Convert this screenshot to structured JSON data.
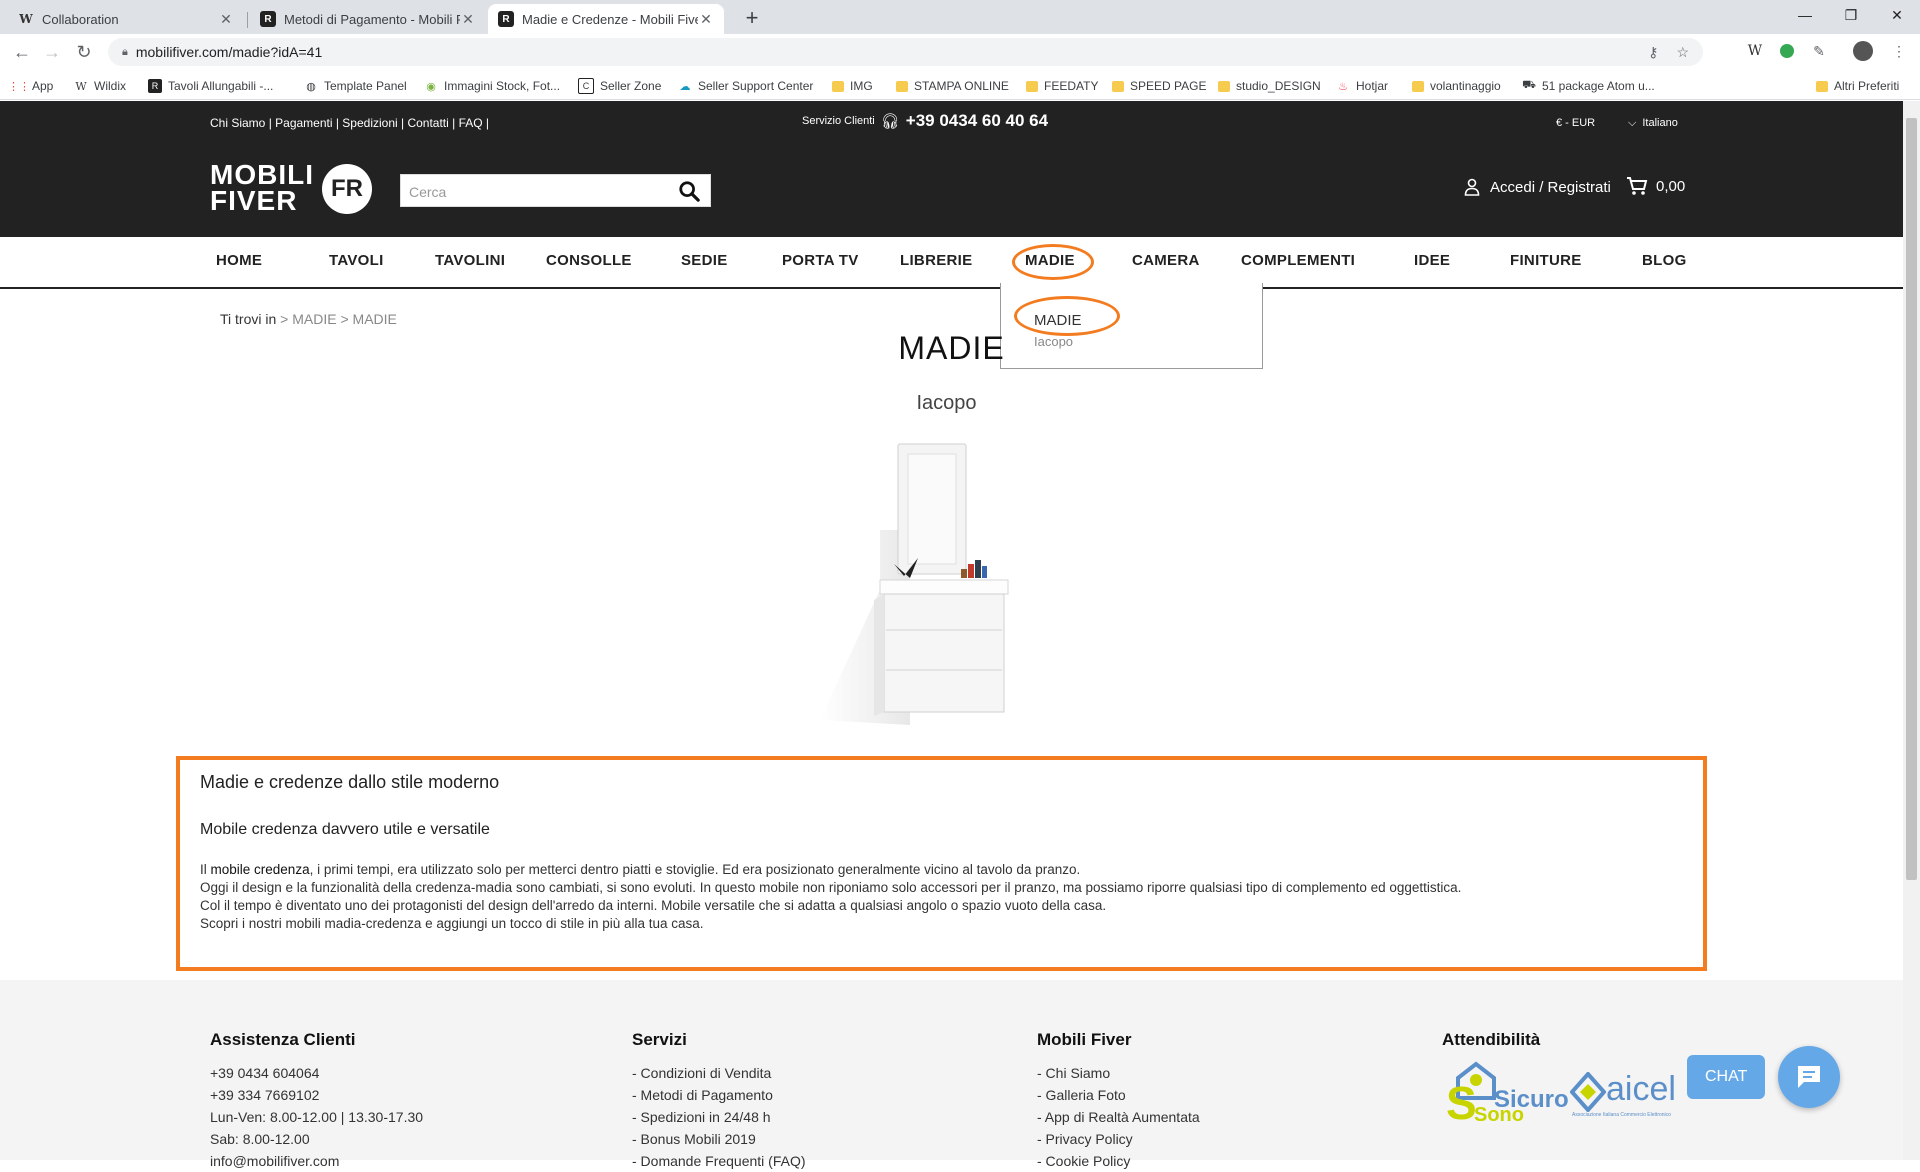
{
  "browser": {
    "tabs": [
      {
        "title": "Collaboration",
        "icon": "W"
      },
      {
        "title": "Metodi di Pagamento - Mobili Fiv",
        "icon": "R"
      },
      {
        "title": "Madie e Credenze - Mobili Fiver",
        "icon": "R"
      }
    ],
    "url": "mobilifiver.com/madie?idA=41",
    "bookmarks": [
      "App",
      "Wildix",
      "Tavoli Allungabili -...",
      "Template Panel",
      "Immagini Stock, Fot...",
      "Seller Zone",
      "Seller Support Center",
      "IMG",
      "STAMPA ONLINE",
      "FEEDATY",
      "SPEED PAGE",
      "studio_DESIGN",
      "Hotjar",
      "volantinaggio",
      "51 package Atom u...",
      "Altri Preferiti"
    ]
  },
  "topbar": {
    "links": "Chi Siamo | Pagamenti | Spedizioni | Contatti | FAQ |",
    "service_label": "Servizio Clienti",
    "phone": "+39 0434 60 40 64",
    "currency": "€ - EUR",
    "language": "Italiano"
  },
  "header": {
    "logo_line1": "MOBILI",
    "logo_line2": "FIVER",
    "logo_badge": "FR",
    "search_placeholder": "Cerca",
    "account": "Accedi / Registrati",
    "cart_total": "0,00"
  },
  "menu": [
    "HOME",
    "TAVOLI",
    "TAVOLINI",
    "CONSOLLE",
    "SEDIE",
    "PORTA TV",
    "LIBRERIE",
    "MADIE",
    "CAMERA",
    "COMPLEMENTI",
    "IDEE",
    "FINITURE",
    "BLOG"
  ],
  "dropdown": [
    "MADIE",
    "Iacopo"
  ],
  "breadcrumb": {
    "prefix": "Ti trovi in",
    "path": " > MADIE > MADIE"
  },
  "page": {
    "title": "MADIE",
    "subcategory": "Iacopo"
  },
  "description": {
    "heading": "Madie e credenze dallo stile moderno",
    "subheading": "Mobile credenza davvero utile e versatile",
    "p1_start": "Il ",
    "p1_bold": "mobile credenza",
    "p1_end": ", i primi tempi, era utilizzato solo per metterci dentro piatti e stoviglie. Ed era posizionato generalmente vicino al tavolo da pranzo.",
    "p2": "Oggi il design e la funzionalità della credenza-madia sono cambiati, si sono evoluti. In questo mobile non riponiamo solo accessori per il pranzo, ma possiamo riporre qualsiasi tipo di complemento ed oggettistica.",
    "p3": "Col il tempo è diventato uno dei protagonisti del design dell'arredo da interni. Mobile versatile che si adatta a qualsiasi angolo o spazio vuoto della casa.",
    "p4": "Scopri i nostri mobili madia-credenza e aggiungi un tocco di stile in più alla tua casa."
  },
  "footer": {
    "assistenza": {
      "title": "Assistenza Clienti",
      "lines": [
        "+39 0434 604064",
        "+39 334 7669102",
        "Lun-Ven: 8.00-12.00 | 13.30-17.30",
        "Sab: 8.00-12.00",
        "info@mobilifiver.com"
      ]
    },
    "servizi": {
      "title": "Servizi",
      "lines": [
        "- Condizioni di Vendita",
        "- Metodi di Pagamento",
        "- Spedizioni in 24/48 h",
        "- Bonus Mobili 2019",
        "- Domande Frequenti (FAQ)"
      ]
    },
    "mobili_fiver": {
      "title": "Mobili Fiver",
      "lines": [
        "- Chi Siamo",
        "- Galleria Foto",
        "- App di Realtà Aumentata",
        "- Privacy Policy",
        "- Cookie Policy"
      ]
    },
    "attendibilita": {
      "title": "Attendibilità",
      "badge1": "Sicuro",
      "badge1_small": "Sono",
      "badge2": "aicel",
      "badge2_small": "Associazione Italiana Commercio Elettronico"
    }
  },
  "chat": {
    "label": "CHAT"
  },
  "colors": {
    "accent_highlight": "#f47c20",
    "header_bg": "#222222",
    "chat": "#64a8e8"
  }
}
